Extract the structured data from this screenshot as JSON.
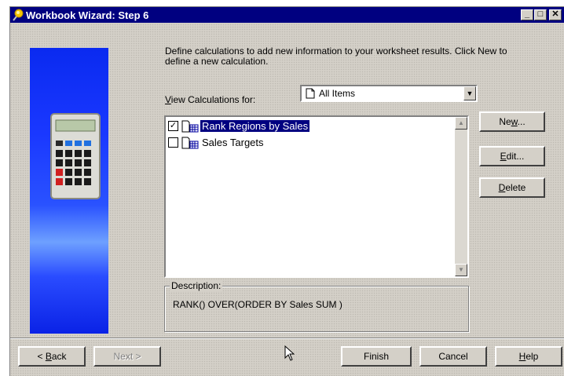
{
  "window": {
    "title": "Workbook Wizard: Step 6",
    "title_icon": "wizard-wand-icon",
    "controls": {
      "minimize": "_",
      "maximize": "□",
      "close": "✕"
    }
  },
  "intro": {
    "text": "Define calculations to add new information to your worksheet results. Click New to define a new calculation."
  },
  "view_for": {
    "label_mnemonic": "V",
    "label_rest": "iew Calculations for:",
    "selected": "All Items",
    "icon": "document-icon"
  },
  "calculations": [
    {
      "label": "Rank Regions by Sales",
      "checked": true,
      "selected": true,
      "icon": "calculation-icon"
    },
    {
      "label": "Sales Targets",
      "checked": false,
      "selected": false,
      "icon": "calculation-icon"
    }
  ],
  "actions": {
    "new": {
      "pre": "Ne",
      "mnemonic": "w",
      "post": "..."
    },
    "edit": {
      "pre": "",
      "mnemonic": "E",
      "post": "dit..."
    },
    "delete": {
      "pre": "",
      "mnemonic": "D",
      "post": "elete"
    }
  },
  "description": {
    "label": "Description:",
    "value": "RANK() OVER(ORDER BY  Sales SUM )"
  },
  "footer": {
    "back": {
      "pre": "< ",
      "mnemonic": "B",
      "post": "ack"
    },
    "next": "Next >",
    "finish": "Finish",
    "cancel": "Cancel",
    "help": {
      "pre": "",
      "mnemonic": "H",
      "post": "elp"
    }
  },
  "colors": {
    "title_bar": "#000080",
    "dialog_face": "#d4d0c8",
    "selection": "#000080",
    "art_blue": "#1a38ff"
  }
}
